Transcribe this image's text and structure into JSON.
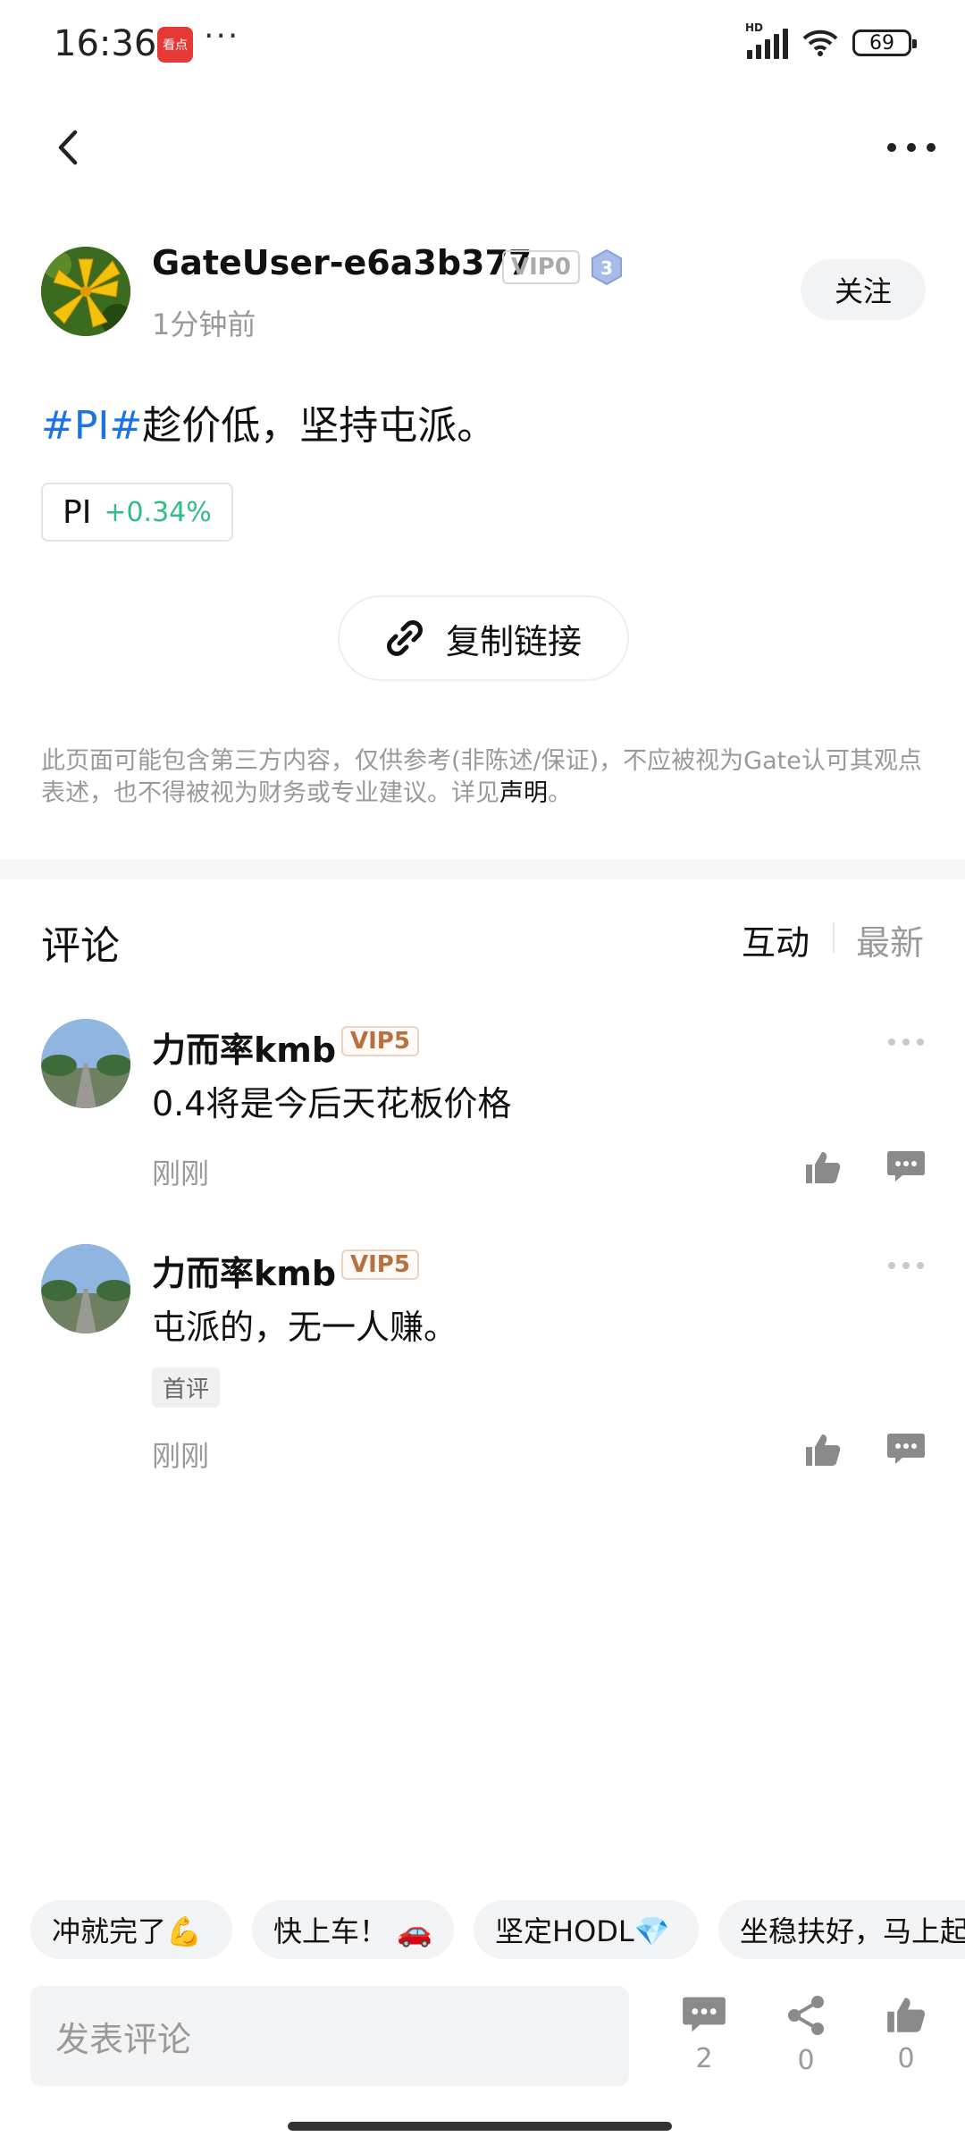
{
  "status_bar": {
    "time": "16:36",
    "app_badge": "看点",
    "dots": "···",
    "network": "HD",
    "battery": "69"
  },
  "post": {
    "author": "GateUser-e6a3b377",
    "vip": "VIP0",
    "level": "3",
    "time": "1分钟前",
    "follow_label": "关注",
    "tag": "#PI#",
    "text": "趁价低，坚持屯派。",
    "coin": {
      "symbol": "PI",
      "change": "+0.34%"
    },
    "copy_link_label": "复制链接",
    "disclaimer_text": "此页面可能包含第三方内容，仅供参考(非陈述/保证)，不应被视为Gate认可其观点表述，也不得被视为财务或专业建议。详见",
    "disclaimer_link": "声明",
    "disclaimer_end": "。"
  },
  "comments_section": {
    "title": "评论",
    "tabs": [
      {
        "label": "互动",
        "active": true
      },
      {
        "label": "最新",
        "active": false
      }
    ],
    "items": [
      {
        "user": "力而率kmb",
        "vip": "VIP5",
        "text": "0.4将是今后天花板价格",
        "badge": "",
        "time": "刚刚"
      },
      {
        "user": "力而率kmb",
        "vip": "VIP5",
        "text": "屯派的，无一人赚。",
        "badge": "首评",
        "time": "刚刚"
      }
    ]
  },
  "quick_replies": [
    "冲就完了💪",
    "快上车！ 🚗",
    "坚定HODL💎",
    "坐稳扶好，马上起"
  ],
  "bottom_bar": {
    "placeholder": "发表评论",
    "comment_count": "2",
    "share_count": "0",
    "like_count": "0"
  },
  "colors": {
    "tag_blue": "#1a73e8",
    "up_green": "#2ebd85",
    "vip5": "#b8703f"
  }
}
